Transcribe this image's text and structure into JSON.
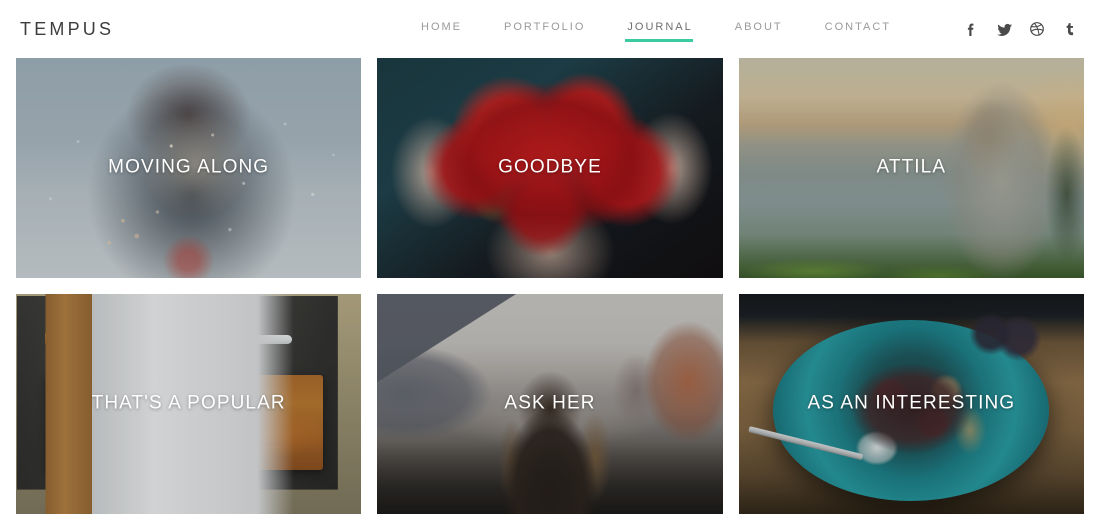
{
  "header": {
    "brand": "TEMPUS",
    "nav": [
      {
        "label": "HOME",
        "active": false
      },
      {
        "label": "PORTFOLIO",
        "active": false
      },
      {
        "label": "JOURNAL",
        "active": true
      },
      {
        "label": "ABOUT",
        "active": false
      },
      {
        "label": "CONTACT",
        "active": false
      }
    ],
    "social": [
      {
        "name": "facebook-icon",
        "glyph": "f"
      },
      {
        "name": "twitter-icon",
        "glyph": "t"
      },
      {
        "name": "dribbble-icon",
        "glyph": "d"
      },
      {
        "name": "tumblr-icon",
        "glyph": "T"
      }
    ]
  },
  "colors": {
    "accent": "#3acca0",
    "nav_text": "#9a9a9a",
    "nav_active_text": "#6f6f6f",
    "brand_text": "#3d3d3d",
    "page_background": "#ffffff",
    "card_title": "#ffffff"
  },
  "grid": {
    "columns": 3,
    "posts": [
      {
        "title": "MOVING ALONG",
        "art": "art-snow",
        "alt": "Woman holding a sparkler in a snowy landscape"
      },
      {
        "title": "GOODBYE",
        "art": "art-berries",
        "alt": "Two hands cupping a pile of fresh strawberries"
      },
      {
        "title": "ATTILA",
        "art": "art-lake",
        "alt": "Woman sitting by a lake at golden hour"
      },
      {
        "title": "THAT'S A POPULAR",
        "art": "art-bread",
        "alt": "Loaf of bread on a dark slate board with a knife"
      },
      {
        "title": "ASK HER",
        "art": "art-canyon",
        "alt": "Woman facing a canyon of mountains at dusk"
      },
      {
        "title": "AS AN INTERESTING",
        "art": "art-plate",
        "alt": "Teal ceramic plate of food with a spoon on wood"
      }
    ]
  }
}
